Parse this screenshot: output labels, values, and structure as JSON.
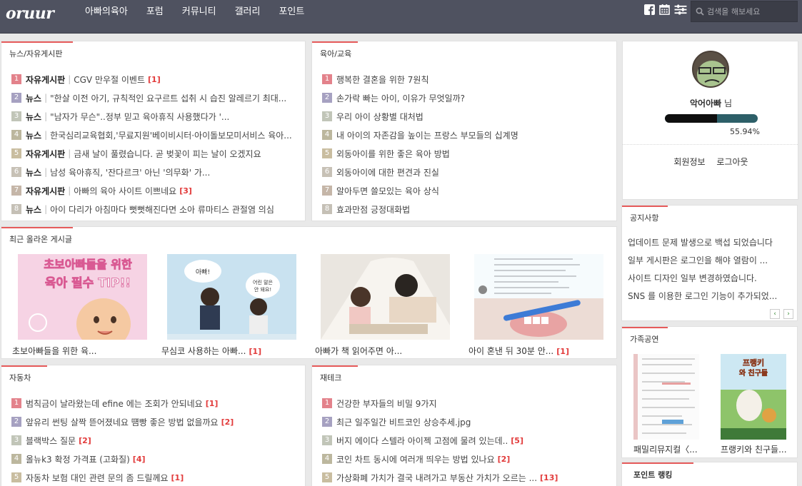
{
  "header": {
    "logo": "oruur",
    "nav": [
      "아빠의육아",
      "포럼",
      "커뮤니티",
      "갤러리",
      "포인트"
    ],
    "icons": [
      "facebook-icon",
      "calendar-icon",
      "menu-icon"
    ],
    "search_placeholder": "검색을 해보세요"
  },
  "news": {
    "title": "뉴스/자유게시판",
    "items": [
      {
        "num": "1",
        "cat": "자유게시판",
        "title": "CGV 만우절 이벤트",
        "count": "[1]"
      },
      {
        "num": "2",
        "cat": "뉴스",
        "title": "\"한살 이전 아기, 규칙적인 요구르트 섭취 시 습진 알레르기 최대...",
        "count": ""
      },
      {
        "num": "3",
        "cat": "뉴스",
        "title": "\"남자가 무슨\"..정부 믿고 육아휴직 사용했다가 '...",
        "count": ""
      },
      {
        "num": "4",
        "cat": "뉴스",
        "title": "한국심리교육협회,'무료지원'베이비시터·아이돌보모미서비스 육아...",
        "count": ""
      },
      {
        "num": "5",
        "cat": "자유게시판",
        "title": "금새 날이 풀렸습니다. 곧 벚꽃이 피는 날이 오겠지요",
        "count": ""
      },
      {
        "num": "6",
        "cat": "뉴스",
        "title": "남성 육아휴직, '잔다르크' 아닌 '의무화' 가...",
        "count": ""
      },
      {
        "num": "7",
        "cat": "자유게시판",
        "title": "아빠의 육아 사이트 이쁘네요",
        "count": "[3]"
      },
      {
        "num": "8",
        "cat": "뉴스",
        "title": "아이 다리가 아침마다 뻣뻣해진다면 소아 류마티스 관절염 의심",
        "count": ""
      }
    ]
  },
  "parenting": {
    "title": "육아/교육",
    "items": [
      {
        "num": "1",
        "title": "행복한 결혼을 위한 7원칙",
        "count": ""
      },
      {
        "num": "2",
        "title": "손가락 빠는 아이, 이유가 무엇일까?",
        "count": ""
      },
      {
        "num": "3",
        "title": "우리 아이 상황별 대처법",
        "count": ""
      },
      {
        "num": "4",
        "title": "내 아이의 자존감을 높이는 프랑스 부모들의 십계명",
        "count": ""
      },
      {
        "num": "5",
        "title": "외동아이를 위한 좋은 육아 방법",
        "count": ""
      },
      {
        "num": "6",
        "title": "외동아이에 대한 편견과 진실",
        "count": ""
      },
      {
        "num": "7",
        "title": "알아두면 쓸모있는 육아 상식",
        "count": ""
      },
      {
        "num": "8",
        "title": "효과만점 긍정대화법",
        "count": ""
      }
    ]
  },
  "gallery": {
    "title": "최근 올라온 게시글",
    "banner_text": [
      "초보아빠들을 위한",
      "육아 필수 TIP!!"
    ],
    "bubble_text": [
      "아빠!",
      "어린 말은",
      "안 돼요!"
    ],
    "items": [
      {
        "caption": "초보아빠들을 위한 육...",
        "count": ""
      },
      {
        "caption": "무심코 사용하는 아빠...",
        "count": "[1]"
      },
      {
        "caption": "아빠가 책 읽어주면 아...",
        "count": ""
      },
      {
        "caption": "아이 혼낸 뒤 30분 안...",
        "count": "[1]"
      }
    ]
  },
  "car": {
    "title": "자동차",
    "items": [
      {
        "num": "1",
        "title": "범칙금이 날라왔는데 efine 에는 조회가 안되네요",
        "count": "[1]"
      },
      {
        "num": "2",
        "title": "앞유리 썬팅 살짝 뜯어졌네요 떔빵 좋은 방법 없을까요",
        "count": "[2]"
      },
      {
        "num": "3",
        "title": "블랙박스 질문",
        "count": "[2]"
      },
      {
        "num": "4",
        "title": "올뉴k3 확정 가격표 (고화질)",
        "count": "[4]"
      },
      {
        "num": "5",
        "title": "자동차 보험 대인 관련 문의 좀 드릴께요",
        "count": "[1]"
      }
    ]
  },
  "finance": {
    "title": "재테크",
    "items": [
      {
        "num": "1",
        "title": "건강한 부자들의 비밀 9가지",
        "count": ""
      },
      {
        "num": "2",
        "title": "최근 일주일간 비트코인 상승추세.jpg",
        "count": ""
      },
      {
        "num": "3",
        "title": "버지 에이다 스텔라 아이젝 고점에 물려 있는데..",
        "count": "[5]"
      },
      {
        "num": "4",
        "title": "코인 차트 동시에 여러개 띄우는 방법 있나요",
        "count": "[2]"
      },
      {
        "num": "5",
        "title": "가상화폐 가치가 결국 내려가고 부동산 가치가 오르는 ...",
        "count": "[13]"
      }
    ]
  },
  "profile": {
    "nickname": "악어아빠",
    "suffix": " 님",
    "percent": "55.94%",
    "progress": 0.5594,
    "links": [
      "회원정보",
      "로그아웃"
    ]
  },
  "notice": {
    "title": "공지사항",
    "items": [
      "업데이트 문제 발생으로 백섭 되었습니다",
      "일부 게시판은 로그인을 해야 열람이 ...",
      "사이트 디자인 일부 변경하였습니다.",
      "SNS 를 이용한 로그인 기능이 추가되었..."
    ],
    "prev": "‹",
    "next": "›"
  },
  "family": {
    "title": "가족공연",
    "poster_text": [
      "프랭키",
      "와 친구들"
    ],
    "items": [
      {
        "caption": "패밀리뮤지컬〈..."
      },
      {
        "caption": "프랭키와 친구들..."
      }
    ]
  },
  "points": {
    "title": "포인트 랭킹"
  },
  "colors": {
    "nav_bg": "#4f5260",
    "accent": "#e65b5b",
    "count": "#e23b3b",
    "bar": "#2d5f68"
  }
}
